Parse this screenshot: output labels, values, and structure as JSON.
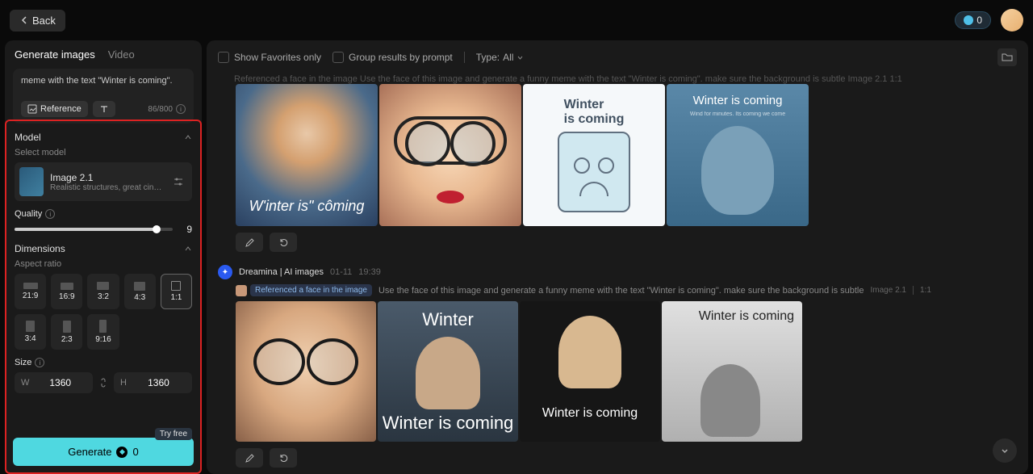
{
  "topbar": {
    "back": "Back",
    "credits": "0"
  },
  "sidebar": {
    "tabs": {
      "images": "Generate images",
      "video": "Video"
    },
    "prompt": "meme with the text \"Winter is coming\".",
    "reference_btn": "Reference",
    "char_count": "86/800",
    "model": {
      "heading": "Model",
      "select_label": "Select model",
      "name": "Image 2.1",
      "desc": "Realistic structures, great cinematog..."
    },
    "quality": {
      "label": "Quality",
      "value": "9"
    },
    "dimensions": {
      "heading": "Dimensions",
      "aspect_label": "Aspect ratio",
      "ratios": [
        "21:9",
        "16:9",
        "3:2",
        "4:3",
        "1:1",
        "3:4",
        "2:3",
        "9:16"
      ],
      "size_label": "Size",
      "w_label": "W",
      "h_label": "H",
      "width": "1360",
      "height": "1360"
    },
    "generate": {
      "label": "Generate",
      "cost": "0",
      "try_free": "Try free"
    }
  },
  "toolbar": {
    "favorites": "Show Favorites only",
    "group": "Group results by prompt",
    "type_label": "Type:",
    "type_value": "All"
  },
  "feed": {
    "partial_head": "Referenced a face in the image   Use the face of this image and generate a funny meme with the text \"Winter is coming\". make sure the background is subtle     Image 2.1     1:1",
    "ref_label": "Referenced a face in the image",
    "prompt_echo": "Use the face of this image and generate a funny meme with the text \"Winter is coming\". make sure the background is subtle",
    "model_tag": "Image 2.1",
    "ratio_tag": "1:1",
    "author": "Dreamina | AI images",
    "date": "01-11",
    "time": "19:39",
    "img1_text": "W'inter is\" côming",
    "img3_t1": "Winter",
    "img3_t2": "is coming",
    "img4_text": "Winter is coming",
    "img4_sub": "Wind for minutes. Its coming we come",
    "imgB2_top": "Winter",
    "imgB2_bot": "Winter is coming",
    "imgB3_text": "Winter is coming",
    "imgB4_text": "Winter is coming"
  }
}
